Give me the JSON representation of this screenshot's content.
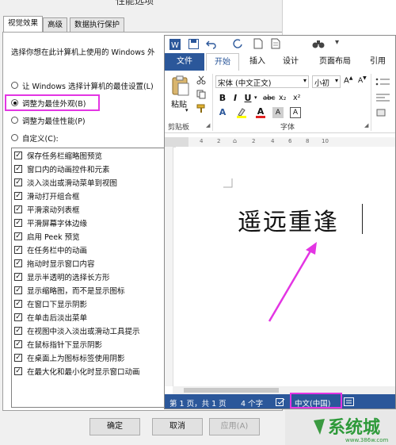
{
  "dialog": {
    "title": "性能选项",
    "tabs": [
      {
        "label": "视觉效果",
        "active": true
      },
      {
        "label": "高级",
        "active": false
      },
      {
        "label": "数据执行保护",
        "active": false
      }
    ],
    "description": "选择你想在此计算机上使用的 Windows 外",
    "radio_options": [
      {
        "label": "让 Windows 选择计算机的最佳设置(L)",
        "selected": false
      },
      {
        "label": "调整为最佳外观(B)",
        "selected": true
      },
      {
        "label": "调整为最佳性能(P)",
        "selected": false
      },
      {
        "label": "自定义(C):",
        "selected": false
      }
    ],
    "effects": [
      {
        "label": "保存任务栏缩略图预览",
        "checked": true
      },
      {
        "label": "窗口内的动画控件和元素",
        "checked": true
      },
      {
        "label": "淡入淡出或滑动菜单到视图",
        "checked": true
      },
      {
        "label": "滑动打开组合框",
        "checked": true
      },
      {
        "label": "平滑滚动列表框",
        "checked": true
      },
      {
        "label": "平滑屏幕字体边缘",
        "checked": true
      },
      {
        "label": "启用 Peek 预览",
        "checked": true
      },
      {
        "label": "在任务栏中的动画",
        "checked": true
      },
      {
        "label": "拖动时显示窗口内容",
        "checked": true
      },
      {
        "label": "显示半透明的选择长方形",
        "checked": true
      },
      {
        "label": "显示缩略图，而不是显示图标",
        "checked": true
      },
      {
        "label": "在窗口下显示阴影",
        "checked": true
      },
      {
        "label": "在单击后淡出菜单",
        "checked": true
      },
      {
        "label": "在视图中淡入淡出或滑动工具提示",
        "checked": true
      },
      {
        "label": "在鼠标指针下显示阴影",
        "checked": true
      },
      {
        "label": "在桌面上为图标标签使用阴影",
        "checked": true
      },
      {
        "label": "在最大化和最小化时显示窗口动画",
        "checked": true
      }
    ],
    "buttons": {
      "ok": "确定",
      "cancel": "取消",
      "apply": "应用(A)"
    }
  },
  "word": {
    "ribbon_tabs": [
      "文件",
      "开始",
      "插入",
      "设计",
      "页面布局",
      "引用"
    ],
    "font_name": "宋体 (中文正文)",
    "font_size": "小初",
    "paste_label": "粘贴",
    "clipboard_label": "剪贴板",
    "font_group_label": "字体",
    "format_buttons": [
      "B",
      "I",
      "U",
      "abc",
      "x₂",
      "x²"
    ],
    "ruler_marks": [
      "4",
      "2",
      "2",
      "4",
      "6",
      "8",
      "10"
    ],
    "document_text": "遥远重逢",
    "status": {
      "page": "第 1 页，共 1 页",
      "words": "4 个字",
      "language": "中文(中国)"
    }
  },
  "colors": {
    "word_blue": "#2b579a",
    "highlight": "#e335e3",
    "watermark_green": "#2e9a3a"
  },
  "watermark": {
    "text": "系统城",
    "url": "www.386w.com"
  }
}
